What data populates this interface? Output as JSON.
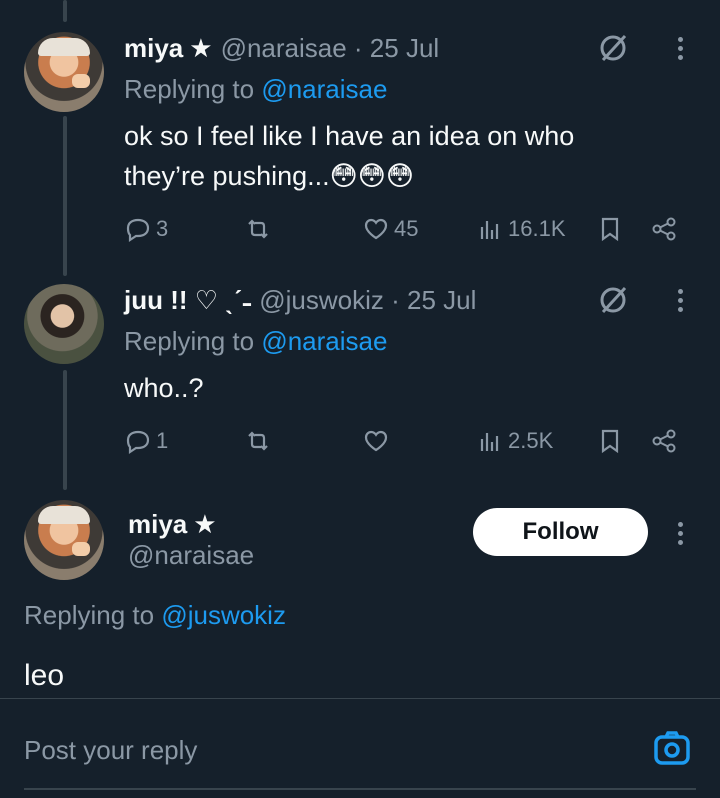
{
  "tweets": [
    {
      "name": "miya",
      "badge": "★",
      "handle": "@naraisae · 25 Jul",
      "replying_prefix": "Replying to ",
      "replying_to": "@naraisae",
      "text_line1": "ok so I feel like I have an idea on who",
      "text_line2": "they’re pushing...😳😳😳",
      "replies": "3",
      "retweets": "",
      "likes": "45",
      "views": "16.1K"
    },
    {
      "name": "juu !! ♡ ˎˊ˗",
      "badge": "",
      "handle": "@juswokiz · 25 Jul",
      "replying_prefix": "Replying to ",
      "replying_to": "@naraisae",
      "text_line1": "who..?",
      "replies": "1",
      "retweets": "",
      "likes": "",
      "views": "2.5K"
    }
  ],
  "main_tweet": {
    "name": "miya",
    "badge": "★",
    "handle": "@naraisae",
    "follow_label": "Follow",
    "replying_prefix": "Replying to ",
    "replying_to": "@juswokiz",
    "text": "leo"
  },
  "reply_box": {
    "placeholder": "Post your reply"
  },
  "icons": {
    "reply": "reply-icon",
    "retweet": "retweet-icon",
    "like": "heart-icon",
    "views": "views-icon",
    "bookmark": "bookmark-icon",
    "share": "share-icon",
    "grok": "grok-icon",
    "more": "more-icon",
    "camera": "camera-icon"
  },
  "colors": {
    "background": "#15202b",
    "link": "#1d9bf0",
    "muted": "#8b98a5",
    "text": "#f7f9f9"
  }
}
